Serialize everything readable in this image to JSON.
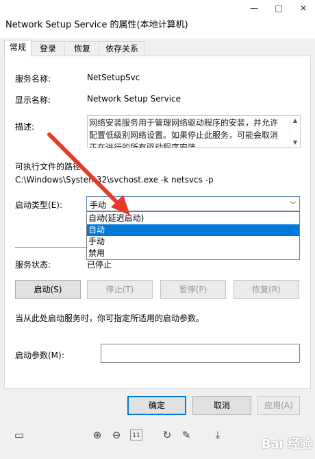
{
  "window": {
    "title": "Network Setup Service 的属性(本地计算机)",
    "minimize_glyph": "—",
    "maximize_glyph": "□",
    "close_glyph": "✕"
  },
  "tabs": [
    {
      "label": "常规",
      "active": true
    },
    {
      "label": "登录",
      "active": false
    },
    {
      "label": "恢复",
      "active": false
    },
    {
      "label": "依存关系",
      "active": false
    }
  ],
  "general": {
    "service_name_label": "服务名称:",
    "service_name_value": "NetSetupSvc",
    "display_name_label": "显示名称:",
    "display_name_value": "Network Setup Service",
    "description_label": "描述:",
    "description_text": "网络安装服务用于管理网络驱动程序的安装，并允许配置低级别网络设置。如果停止此服务，可能会取消正在进行的所有驱动程序安装。",
    "exe_path_label": "可执行文件的路径:",
    "exe_path_value": "C:\\Windows\\System32\\svchost.exe -k netsvcs -p",
    "startup_type_label": "启动类型(E):",
    "startup_type_value": "手动",
    "startup_type_options": [
      "自动(延迟启动)",
      "自动",
      "手动",
      "禁用"
    ],
    "startup_type_highlighted": "自动",
    "service_status_label": "服务状态:",
    "service_status_value": "已停止",
    "start_button": "启动(S)",
    "stop_button": "停止(T)",
    "pause_button": "暂停(P)",
    "resume_button": "恢复(R)",
    "hint_text": "当从此处启动服务时，你可指定所适用的启动参数。",
    "start_params_label": "启动参数(M):",
    "start_params_value": ""
  },
  "dialog_buttons": {
    "ok": "确定",
    "cancel": "取消",
    "apply": "应用(A)"
  },
  "viewer_toolbar": {
    "page_number": "11"
  },
  "colors": {
    "accent": "#0078d7",
    "annotation_arrow": "#e8392b"
  },
  "watermark": "Bai 经验"
}
